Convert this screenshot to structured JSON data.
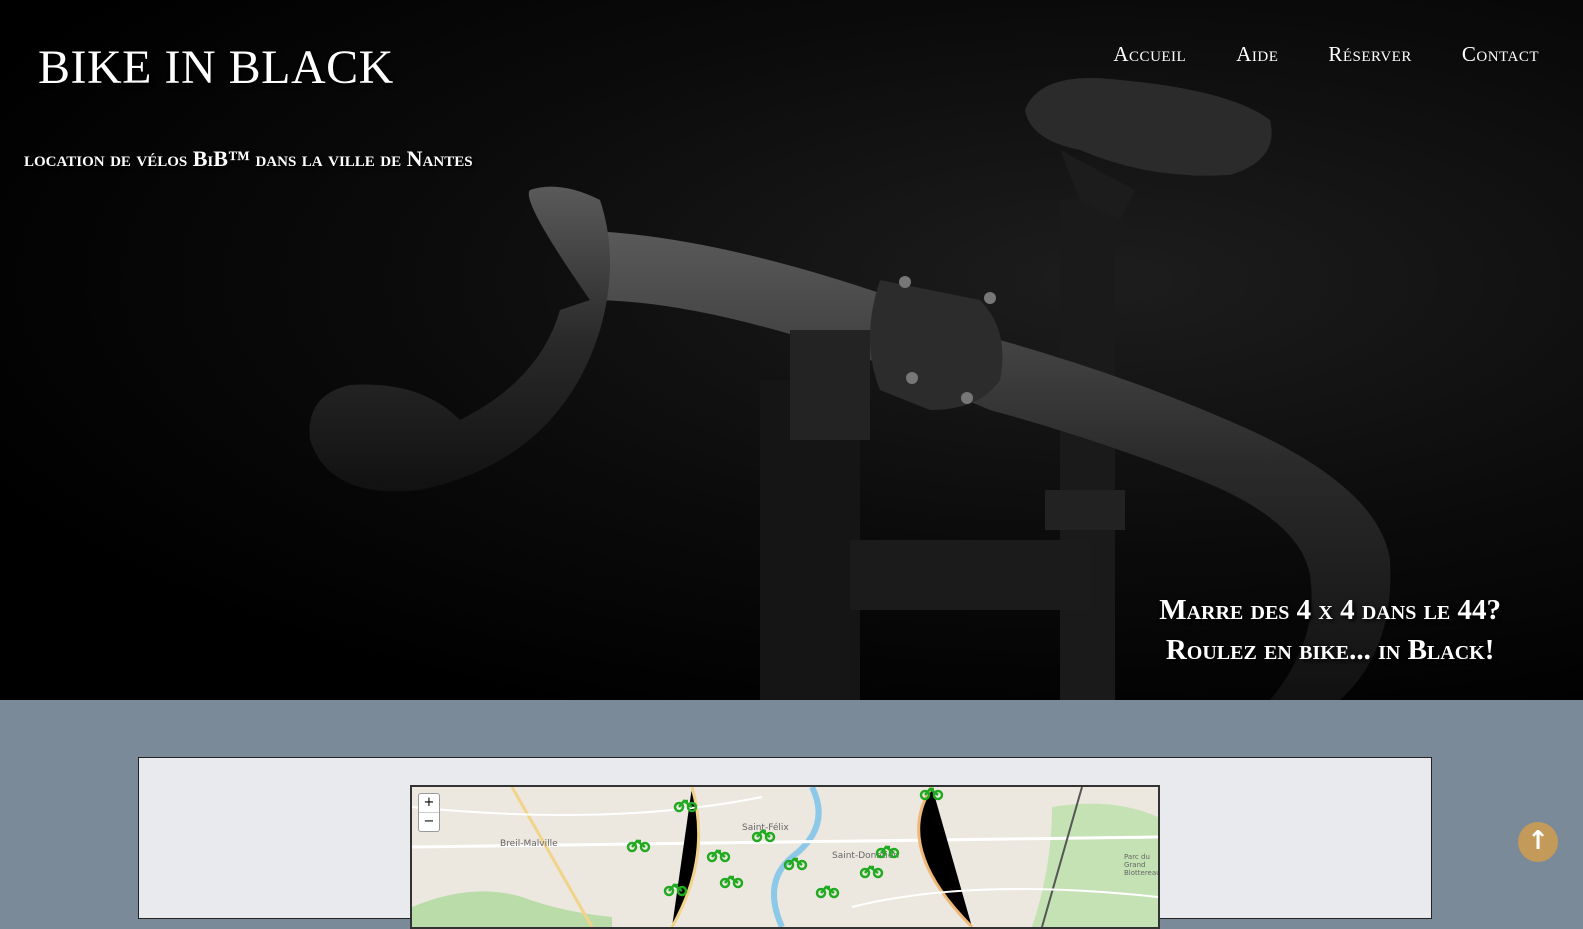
{
  "header": {
    "brand": "BIKE IN BLACK",
    "nav": [
      "Accueil",
      "Aide",
      "Réserver",
      "Contact"
    ],
    "tagline": "location de vélos BiB™ dans la ville de Nantes",
    "slogan_line1": "Marre des 4 x 4 dans le 44?",
    "slogan_line2": "Roulez en bike... in Black!"
  },
  "map": {
    "zoom_in": "+",
    "zoom_out": "−",
    "labels": [
      "Breil-Malville",
      "Saint-Félix",
      "Saint-Donatien",
      "Parc du Grand Blottereau"
    ]
  },
  "scroll_top_icon": "arrow-up-icon",
  "colors": {
    "section_bg": "#7a8a99",
    "panel_bg": "#e8eaee",
    "scroll_button": "#c49a5a",
    "bike_marker": "#22aa22"
  }
}
